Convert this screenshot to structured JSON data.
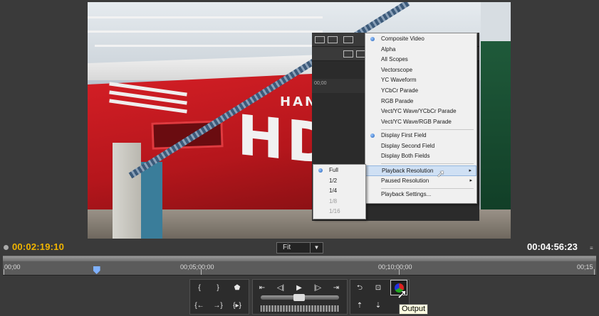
{
  "viewer": {
    "hull_letters": "HD",
    "hull_letters_small": "HAN"
  },
  "overlay": {
    "timecode_fragment": "00;00",
    "main_menu": [
      {
        "label": "Composite Video",
        "checked": true
      },
      {
        "label": "Alpha"
      },
      {
        "label": "All Scopes"
      },
      {
        "label": "Vectorscope"
      },
      {
        "label": "YC Waveform"
      },
      {
        "label": "YCbCr Parade"
      },
      {
        "label": "RGB Parade"
      },
      {
        "label": "Vect/YC Wave/YCbCr Parade"
      },
      {
        "label": "Vect/YC Wave/RGB Parade"
      },
      {
        "label": "Display First Field",
        "checked": true
      },
      {
        "label": "Display Second Field"
      },
      {
        "label": "Display Both Fields"
      },
      {
        "label": "Playback Resolution",
        "submenu": true,
        "highlighted": true
      },
      {
        "label": "Paused Resolution",
        "submenu": true
      },
      {
        "label": "Playback Settings..."
      }
    ],
    "submenu": [
      {
        "label": "Full",
        "checked": true
      },
      {
        "label": "1/2"
      },
      {
        "label": "1/4"
      },
      {
        "label": "1/8",
        "disabled": true
      },
      {
        "label": "1/16",
        "disabled": true
      }
    ]
  },
  "timecode": {
    "current": "00:02:19:10",
    "duration": "00:04:56:23",
    "current_color": "#f0b400"
  },
  "zoom": {
    "selected": "Fit"
  },
  "ruler": {
    "labels": [
      "00;00",
      "00;05;00;00",
      "00;10;00;00",
      "00;15"
    ],
    "playhead_fraction": 0.158
  },
  "transport": {
    "mark_in_icon": "mark-in-icon",
    "tooltip": "Output"
  }
}
